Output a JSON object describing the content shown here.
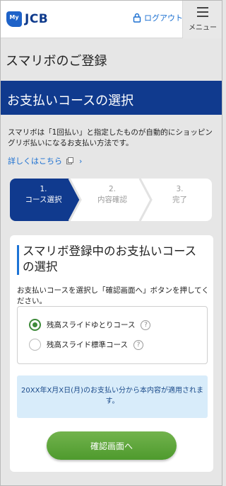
{
  "header": {
    "logo_my": "My",
    "logo_brand": "JCB",
    "logout_label": "ログアウト",
    "menu_label": "メニュー"
  },
  "page": {
    "title": "スマリボのご登録",
    "section_title": "お支払いコースの選択",
    "description": "スマリボは「1回払い」と指定したものが自動的にショッピングリボ払いになるお支払い方法です。",
    "detail_link": "詳しくはこちら"
  },
  "stepper": {
    "current_step": 1,
    "steps": [
      {
        "num": "1.",
        "label": "コース選択"
      },
      {
        "num": "2.",
        "label": "内容確認"
      },
      {
        "num": "3.",
        "label": "完了"
      }
    ]
  },
  "card": {
    "title": "スマリボ登録中のお支払いコースの選択",
    "instruction": "お支払いコースを選択し「確認画面へ」ボタンを押してください。",
    "options": [
      {
        "label": "残高スライドゆとりコース",
        "selected": true
      },
      {
        "label": "残高スライド標準コース",
        "selected": false
      }
    ],
    "notice": "20XX年X月X日(月)のお支払い分から本内容が適用されます。",
    "confirm_label": "確認画面へ"
  },
  "colors": {
    "brand_navy": "#103a8e",
    "link_blue": "#1a6fd1",
    "accent_green": "#4e9a2d",
    "notice_bg": "#d8ecfa"
  }
}
